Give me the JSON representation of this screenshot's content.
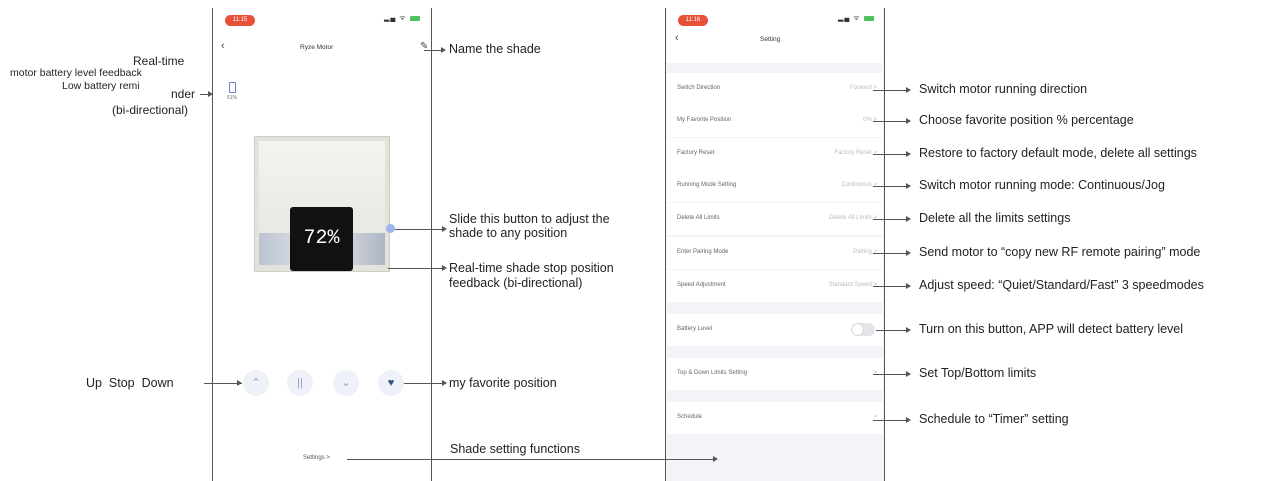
{
  "left_phone": {
    "status_time": "11:15",
    "back_icon": "chevron-left-icon",
    "title": "Ryze Motor",
    "edit_icon": "pencil-icon",
    "battery_percent": "51%",
    "position_value": "72%",
    "controls": [
      {
        "icon": "chevron-up-icon",
        "glyph": "⌃"
      },
      {
        "icon": "pause-icon",
        "glyph": "||"
      },
      {
        "icon": "chevron-down-icon",
        "glyph": "⌄"
      },
      {
        "icon": "heart-icon",
        "glyph": "♥"
      }
    ],
    "settings_link": "Settings >"
  },
  "right_phone": {
    "status_time": "11:16",
    "back_icon": "chevron-left-icon",
    "title": "Setting",
    "rows": [
      {
        "label": "Switch Direction",
        "value": "Forward >"
      },
      {
        "label": "My Favorite Position",
        "value": "0% >"
      },
      {
        "label": "Factory Reset",
        "value": "Factory Reset >"
      },
      {
        "label": "Running Mode Setting",
        "value": "Continuous >"
      },
      {
        "label": "Delete All Limits",
        "value": "Delete All Limits >"
      },
      {
        "label": "Enter Pairing Mode",
        "value": "Pairing >"
      },
      {
        "label": "Speed Adjustment",
        "value": "Standard Speed >"
      }
    ],
    "battery_row": {
      "label": "Battery Level",
      "toggle_on": false
    },
    "limits_row": {
      "label": "Top & Down Limits Setting",
      "value": ">"
    },
    "schedule_row": {
      "label": "Schedule",
      "value": ">"
    }
  },
  "annotations": {
    "realtime_1": "Real-time",
    "realtime_2": "motor battery level feedback",
    "low_battery_1": "Low battery remi",
    "low_battery_2": "nder",
    "bidirectional": "(bi-directional)",
    "name_shade": "Name the shade",
    "slide_1": "Slide this button to adjust the",
    "slide_2": "shade to any position",
    "stop_1": "Real-time shade stop position",
    "stop_2": "feedback (bi-directional)",
    "up_stop_down": "Up  Stop  Down",
    "favorite": "my favorite position",
    "shade_settings": "Shade setting functions",
    "right": [
      "Switch motor running direction",
      "Choose favorite position % percentage",
      "Restore to factory default mode, delete all settings",
      "Switch motor running mode: Continuous/Jog",
      "Delete all the limits settings",
      "Send motor to “copy new RF remote pairing” mode",
      "Adjust speed: “Quiet/Standard/Fast” 3 speedmodes",
      "Turn on this button, APP will detect battery level",
      "Set Top/Bottom limits",
      "Schedule to “Timer” setting"
    ]
  },
  "colors": {
    "accent": "#e8503a",
    "control_bg": "#eef1f8",
    "control_fg": "#8b9bc6",
    "battery_green": "#4cc262"
  }
}
